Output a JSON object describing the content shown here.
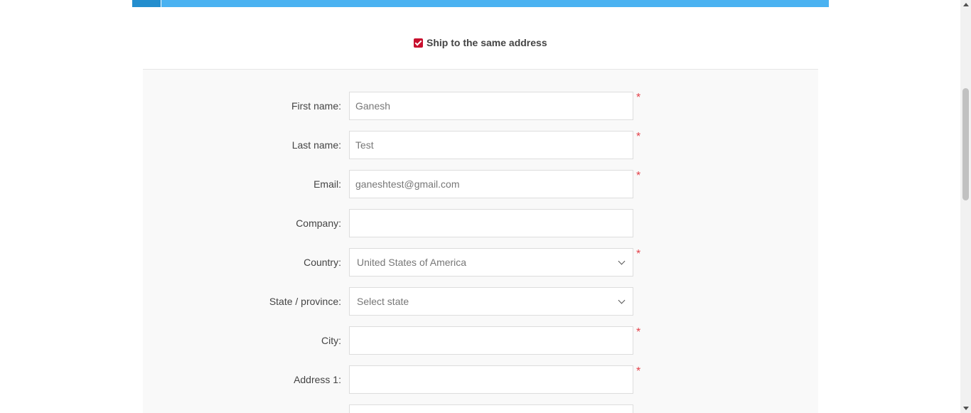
{
  "ship_same": {
    "label": "Ship to the same address",
    "checked": true
  },
  "form": {
    "required_mark": "*",
    "fields": {
      "first_name": {
        "label": "First name:",
        "value": "Ganesh"
      },
      "last_name": {
        "label": "Last name:",
        "value": "Test"
      },
      "email": {
        "label": "Email:",
        "value": "ganeshtest@gmail.com"
      },
      "company": {
        "label": "Company:",
        "value": ""
      },
      "country": {
        "label": "Country:",
        "value": "United States of America"
      },
      "state": {
        "label": "State / province:",
        "value": "Select state"
      },
      "city": {
        "label": "City:",
        "value": ""
      },
      "address1": {
        "label": "Address 1:",
        "value": ""
      }
    }
  },
  "colors": {
    "step_bar": "#4ab2f1",
    "step_active": "#248ece",
    "checkbox": "#c8102e",
    "required": "#e4434b",
    "panel_bg": "#f9f9f9"
  }
}
